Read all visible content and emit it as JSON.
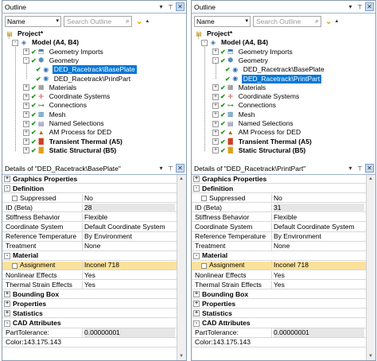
{
  "panels": [
    {
      "outline_title": "Outline",
      "name_filter": "Name",
      "search_placeholder": "Search Outline",
      "tree": [
        {
          "label": "Project*",
          "level": 0,
          "icon": "project-icon",
          "bold": true,
          "toggle": "",
          "selected": false
        },
        {
          "label": "Model (A4, B4)",
          "level": 1,
          "icon": "model-icon",
          "bold": true,
          "toggle": "-",
          "selected": false
        },
        {
          "label": "Geometry Imports",
          "level": 2,
          "icon": "geometry-imports-icon",
          "bold": false,
          "toggle": "+",
          "selected": false
        },
        {
          "label": "Geometry",
          "level": 2,
          "icon": "geometry-icon",
          "bold": false,
          "toggle": "-",
          "selected": false
        },
        {
          "label": "DED_Racetrack\\BasePlate",
          "level": 3,
          "icon": "body-icon",
          "bold": false,
          "toggle": "",
          "selected": true
        },
        {
          "label": "DED_Racetrack\\PrintPart",
          "level": 3,
          "icon": "body-icon",
          "bold": false,
          "toggle": "",
          "selected": false
        },
        {
          "label": "Materials",
          "level": 2,
          "icon": "materials-icon",
          "bold": false,
          "toggle": "+",
          "selected": false
        },
        {
          "label": "Coordinate Systems",
          "level": 2,
          "icon": "coordinate-systems-icon",
          "bold": false,
          "toggle": "+",
          "selected": false
        },
        {
          "label": "Connections",
          "level": 2,
          "icon": "connections-icon",
          "bold": false,
          "toggle": "+",
          "selected": false
        },
        {
          "label": "Mesh",
          "level": 2,
          "icon": "mesh-icon",
          "bold": false,
          "toggle": "+",
          "selected": false
        },
        {
          "label": "Named Selections",
          "level": 2,
          "icon": "named-selections-icon",
          "bold": false,
          "toggle": "+",
          "selected": false
        },
        {
          "label": "AM Process for DED",
          "level": 2,
          "icon": "am-process-icon",
          "bold": false,
          "toggle": "+",
          "selected": false
        },
        {
          "label": "Transient Thermal (A5)",
          "level": 2,
          "icon": "transient-thermal-icon",
          "bold": true,
          "toggle": "+",
          "selected": false
        },
        {
          "label": "Static Structural (B5)",
          "level": 2,
          "icon": "static-structural-icon",
          "bold": true,
          "toggle": "+",
          "selected": false
        }
      ],
      "details_title": "Details of \"DED_Racetrack\\BasePlate\"",
      "details": [
        {
          "type": "cat",
          "label": "Graphics Properties",
          "toggle": "+"
        },
        {
          "type": "cat",
          "label": "Definition",
          "toggle": "-"
        },
        {
          "type": "prop",
          "label": "Suppressed",
          "value": "No",
          "checkbox": true
        },
        {
          "type": "prop",
          "label": "ID (Beta)",
          "value": "28",
          "gray": true
        },
        {
          "type": "prop",
          "label": "Stiffness Behavior",
          "value": "Flexible"
        },
        {
          "type": "prop",
          "label": "Coordinate System",
          "value": "Default Coordinate System"
        },
        {
          "type": "prop",
          "label": "Reference Temperature",
          "value": "By Environment"
        },
        {
          "type": "prop",
          "label": "Treatment",
          "value": "None"
        },
        {
          "type": "cat",
          "label": "Material",
          "toggle": "-"
        },
        {
          "type": "prop",
          "label": "Assignment",
          "value": "Inconel 718",
          "checkbox": true,
          "highlight": true
        },
        {
          "type": "prop",
          "label": "Nonlinear Effects",
          "value": "Yes"
        },
        {
          "type": "prop",
          "label": "Thermal Strain Effects",
          "value": "Yes"
        },
        {
          "type": "cat",
          "label": "Bounding Box",
          "toggle": "+"
        },
        {
          "type": "cat",
          "label": "Properties",
          "toggle": "+"
        },
        {
          "type": "cat",
          "label": "Statistics",
          "toggle": "+"
        },
        {
          "type": "cat",
          "label": "CAD Attributes",
          "toggle": "-"
        },
        {
          "type": "prop",
          "label": "PartTolerance:",
          "value": "0.00000001",
          "gray": true
        },
        {
          "type": "prop",
          "label": "Color:143.175.143",
          "value": "",
          "gray": true
        }
      ]
    },
    {
      "outline_title": "Outline",
      "name_filter": "Name",
      "search_placeholder": "Search Outline",
      "tree": [
        {
          "label": "Project*",
          "level": 0,
          "icon": "project-icon",
          "bold": true,
          "toggle": "",
          "selected": false
        },
        {
          "label": "Model (A4, B4)",
          "level": 1,
          "icon": "model-icon",
          "bold": true,
          "toggle": "-",
          "selected": false
        },
        {
          "label": "Geometry Imports",
          "level": 2,
          "icon": "geometry-imports-icon",
          "bold": false,
          "toggle": "+",
          "selected": false
        },
        {
          "label": "Geometry",
          "level": 2,
          "icon": "geometry-icon",
          "bold": false,
          "toggle": "-",
          "selected": false
        },
        {
          "label": "DED_Racetrack\\BasePlate",
          "level": 3,
          "icon": "body-icon",
          "bold": false,
          "toggle": "",
          "selected": false
        },
        {
          "label": "DED_Racetrack\\PrintPart",
          "level": 3,
          "icon": "body-icon",
          "bold": false,
          "toggle": "",
          "selected": true
        },
        {
          "label": "Materials",
          "level": 2,
          "icon": "materials-icon",
          "bold": false,
          "toggle": "+",
          "selected": false
        },
        {
          "label": "Coordinate Systems",
          "level": 2,
          "icon": "coordinate-systems-icon",
          "bold": false,
          "toggle": "+",
          "selected": false
        },
        {
          "label": "Connections",
          "level": 2,
          "icon": "connections-icon",
          "bold": false,
          "toggle": "+",
          "selected": false
        },
        {
          "label": "Mesh",
          "level": 2,
          "icon": "mesh-icon",
          "bold": false,
          "toggle": "+",
          "selected": false
        },
        {
          "label": "Named Selections",
          "level": 2,
          "icon": "named-selections-icon",
          "bold": false,
          "toggle": "+",
          "selected": false
        },
        {
          "label": "AM Process for DED",
          "level": 2,
          "icon": "am-process-icon",
          "bold": false,
          "toggle": "+",
          "selected": false
        },
        {
          "label": "Transient Thermal (A5)",
          "level": 2,
          "icon": "transient-thermal-icon",
          "bold": true,
          "toggle": "+",
          "selected": false
        },
        {
          "label": "Static Structural (B5)",
          "level": 2,
          "icon": "static-structural-icon",
          "bold": true,
          "toggle": "+",
          "selected": false
        }
      ],
      "details_title": "Details of \"DED_Racetrack\\PrintPart\"",
      "details": [
        {
          "type": "cat",
          "label": "Graphics Properties",
          "toggle": "+"
        },
        {
          "type": "cat",
          "label": "Definition",
          "toggle": "-"
        },
        {
          "type": "prop",
          "label": "Suppressed",
          "value": "No",
          "checkbox": true
        },
        {
          "type": "prop",
          "label": "ID (Beta)",
          "value": "31",
          "gray": true
        },
        {
          "type": "prop",
          "label": "Stiffness Behavior",
          "value": "Flexible"
        },
        {
          "type": "prop",
          "label": "Coordinate System",
          "value": "Default Coordinate System"
        },
        {
          "type": "prop",
          "label": "Reference Temperature",
          "value": "By Environment"
        },
        {
          "type": "prop",
          "label": "Treatment",
          "value": "None"
        },
        {
          "type": "cat",
          "label": "Material",
          "toggle": "-"
        },
        {
          "type": "prop",
          "label": "Assignment",
          "value": "Inconel 718",
          "checkbox": true,
          "highlight": true
        },
        {
          "type": "prop",
          "label": "Nonlinear Effects",
          "value": "Yes"
        },
        {
          "type": "prop",
          "label": "Thermal Strain Effects",
          "value": "Yes"
        },
        {
          "type": "cat",
          "label": "Bounding Box",
          "toggle": "+"
        },
        {
          "type": "cat",
          "label": "Properties",
          "toggle": "+"
        },
        {
          "type": "cat",
          "label": "Statistics",
          "toggle": "+"
        },
        {
          "type": "cat",
          "label": "CAD Attributes",
          "toggle": "-"
        },
        {
          "type": "prop",
          "label": "PartTolerance:",
          "value": "0.00000001",
          "gray": true
        },
        {
          "type": "prop",
          "label": "Color:143.175.143",
          "value": "",
          "gray": true
        }
      ]
    }
  ],
  "header_buttons": {
    "dropdown": "▾",
    "pin": "📌",
    "close": "✕"
  },
  "colors": {
    "selection": "#0078d7",
    "highlight": "#fbe29c",
    "check": "#1a9a1a"
  }
}
